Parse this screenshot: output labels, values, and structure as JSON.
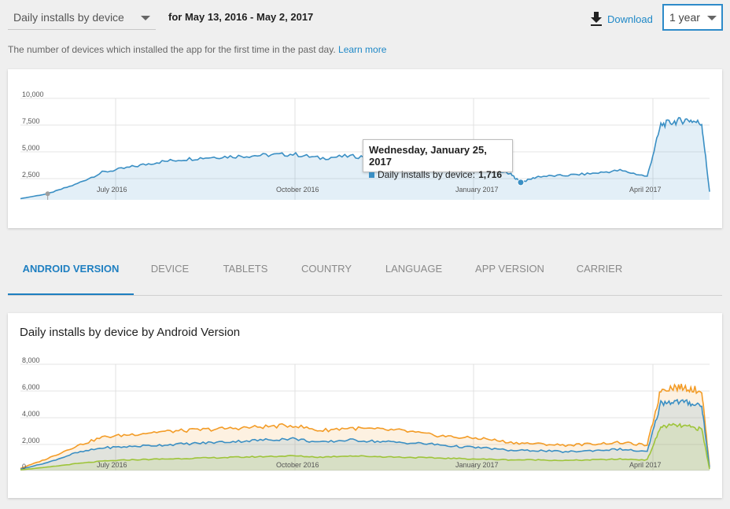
{
  "header": {
    "metric_select": "Daily installs by device",
    "date_range": "for May 13, 2016 - May 2, 2017",
    "download_label": "Download",
    "period_select": "1 year"
  },
  "description": {
    "text": "The number of devices which installed the app for the first time in the past day.",
    "link": "Learn more"
  },
  "colors": {
    "accent": "#1e7fc1",
    "primary_series": "#3a8fc4",
    "orange_series": "#f39c27",
    "green_series": "#9ec43a"
  },
  "tooltip": {
    "title": "Wednesday, January 25, 2017",
    "series": "Daily installs by device:",
    "value": "1,716"
  },
  "tabs": [
    {
      "label": "ANDROID VERSION",
      "active": true
    },
    {
      "label": "DEVICE",
      "active": false
    },
    {
      "label": "TABLETS",
      "active": false
    },
    {
      "label": "COUNTRY",
      "active": false
    },
    {
      "label": "LANGUAGE",
      "active": false
    },
    {
      "label": "APP VERSION",
      "active": false
    },
    {
      "label": "CARRIER",
      "active": false
    }
  ],
  "breakdown_title": "Daily installs by device by Android Version",
  "chart_data": [
    {
      "type": "area",
      "title": "",
      "xlabel": "",
      "ylabel": "",
      "x_ticks": [
        "July 2016",
        "October 2016",
        "January 2017",
        "April 2017"
      ],
      "y_ticks": [
        "10,000",
        "7,500",
        "5,000",
        "2,500"
      ],
      "ylim": [
        0,
        10000
      ],
      "grid": true,
      "series": [
        {
          "color": "#3a8fc4",
          "x": [
            "2016-05-13",
            "2016-05-27",
            "2016-06-10",
            "2016-06-24",
            "2016-07-08",
            "2016-07-22",
            "2016-08-05",
            "2016-08-19",
            "2016-09-02",
            "2016-09-16",
            "2016-09-30",
            "2016-10-14",
            "2016-10-28",
            "2016-11-11",
            "2016-11-25",
            "2016-12-09",
            "2016-12-23",
            "2017-01-06",
            "2017-01-20",
            "2017-01-25",
            "2017-02-03",
            "2017-02-17",
            "2017-03-03",
            "2017-03-17",
            "2017-03-31",
            "2017-04-07",
            "2017-04-14",
            "2017-04-21",
            "2017-04-28",
            "2017-05-02"
          ],
          "values": [
            120,
            600,
            1500,
            2700,
            3200,
            3700,
            4000,
            4200,
            4300,
            4400,
            4500,
            4100,
            4300,
            4200,
            4000,
            3800,
            3600,
            3300,
            2500,
            1716,
            2300,
            2400,
            2600,
            2900,
            2300,
            7400,
            7700,
            7900,
            7500,
            800
          ]
        }
      ]
    },
    {
      "type": "area",
      "title": "Daily installs by device by Android Version",
      "xlabel": "",
      "ylabel": "",
      "x_ticks": [
        "July 2016",
        "October 2016",
        "January 2017",
        "April 2017"
      ],
      "y_ticks": [
        "8,000",
        "6,000",
        "4,000",
        "2,000",
        "0"
      ],
      "ylim": [
        0,
        8000
      ],
      "grid": true,
      "series": [
        {
          "color": "#f39c27",
          "x": [
            "2016-05-13",
            "2016-05-27",
            "2016-06-10",
            "2016-06-24",
            "2016-07-08",
            "2016-07-22",
            "2016-08-05",
            "2016-08-19",
            "2016-09-02",
            "2016-09-16",
            "2016-09-30",
            "2016-10-14",
            "2016-10-28",
            "2016-11-11",
            "2016-11-25",
            "2016-12-09",
            "2016-12-23",
            "2017-01-06",
            "2017-01-20",
            "2017-02-03",
            "2017-02-17",
            "2017-03-03",
            "2017-03-17",
            "2017-03-31",
            "2017-04-07",
            "2017-04-14",
            "2017-04-21",
            "2017-04-28",
            "2017-05-02"
          ],
          "values": [
            150,
            900,
            1800,
            2500,
            2700,
            2900,
            3000,
            3100,
            3200,
            3300,
            3400,
            3000,
            3200,
            3100,
            3000,
            2700,
            2500,
            2400,
            2100,
            2000,
            1900,
            2000,
            2100,
            1900,
            6100,
            6300,
            6200,
            6000,
            300
          ]
        },
        {
          "color": "#3a8fc4",
          "x": [
            "2016-05-13",
            "2016-05-27",
            "2016-06-10",
            "2016-06-24",
            "2016-07-08",
            "2016-07-22",
            "2016-08-05",
            "2016-08-19",
            "2016-09-02",
            "2016-09-16",
            "2016-09-30",
            "2016-10-14",
            "2016-10-28",
            "2016-11-11",
            "2016-11-25",
            "2016-12-09",
            "2016-12-23",
            "2017-01-06",
            "2017-01-20",
            "2017-02-03",
            "2017-02-17",
            "2017-03-03",
            "2017-03-17",
            "2017-03-31",
            "2017-04-07",
            "2017-04-14",
            "2017-04-21",
            "2017-04-28",
            "2017-05-02"
          ],
          "values": [
            100,
            600,
            1300,
            1700,
            1800,
            1900,
            2000,
            2100,
            2200,
            2300,
            2400,
            2100,
            2300,
            2200,
            2100,
            2000,
            1800,
            1700,
            1500,
            1500,
            1400,
            1500,
            1600,
            1400,
            5100,
            5200,
            5100,
            4900,
            200
          ]
        },
        {
          "color": "#9ec43a",
          "x": [
            "2016-05-13",
            "2016-05-27",
            "2016-06-10",
            "2016-06-24",
            "2016-07-08",
            "2016-07-22",
            "2016-08-05",
            "2016-08-19",
            "2016-09-02",
            "2016-09-16",
            "2016-09-30",
            "2016-10-14",
            "2016-10-28",
            "2016-11-11",
            "2016-11-25",
            "2016-12-09",
            "2016-12-23",
            "2017-01-06",
            "2017-01-20",
            "2017-02-03",
            "2017-02-17",
            "2017-03-03",
            "2017-03-17",
            "2017-03-31",
            "2017-04-07",
            "2017-04-14",
            "2017-04-21",
            "2017-04-28",
            "2017-05-02"
          ],
          "values": [
            50,
            250,
            500,
            700,
            800,
            850,
            900,
            950,
            1000,
            1050,
            1100,
            1000,
            1100,
            1050,
            1000,
            950,
            900,
            850,
            800,
            800,
            750,
            800,
            850,
            800,
            3300,
            3400,
            3300,
            3100,
            100
          ]
        }
      ]
    }
  ]
}
